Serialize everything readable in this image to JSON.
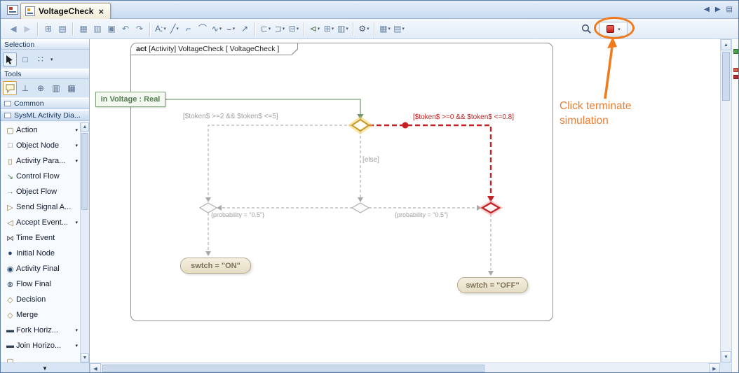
{
  "tab_bar": {
    "tab": {
      "title": "VoltageCheck",
      "close_glyph": "×"
    },
    "nav_prev": "◀",
    "nav_next": "▶",
    "nav_list": "▤"
  },
  "toolbar": {
    "groups": {
      "g1": [
        {
          "name": "back-button",
          "icon": "back-icon",
          "glyph": "◀",
          "color": "#7c95b6"
        },
        {
          "name": "forward-button",
          "icon": "forward-icon",
          "glyph": "▶",
          "color": "#b9c6d8"
        }
      ],
      "g2": [
        {
          "name": "open-diagram-button",
          "icon": "diagram-window-icon",
          "glyph": "⊞",
          "color": "#5f7da6"
        },
        {
          "name": "specification-button",
          "icon": "specification-icon",
          "glyph": "▤",
          "color": "#5f7da6"
        }
      ],
      "g3": [
        {
          "name": "print-button",
          "icon": "printer-icon",
          "glyph": "▦"
        },
        {
          "name": "copy-button",
          "icon": "copy-icon",
          "glyph": "▥"
        },
        {
          "name": "paste-button",
          "icon": "paste-icon",
          "glyph": "▣"
        },
        {
          "name": "undo-button",
          "icon": "undo-icon",
          "glyph": "↶"
        },
        {
          "name": "redo-button",
          "icon": "redo-icon",
          "glyph": "↷"
        }
      ],
      "g4": [
        {
          "name": "dependency-button",
          "icon": "dependency-icon",
          "glyph": "A:",
          "color": "#4a6a94",
          "caret": true
        },
        {
          "name": "oblique-path-button",
          "icon": "oblique-line-icon",
          "glyph": "╱",
          "color": "#4a6a94",
          "caret": true
        },
        {
          "name": "rectilinear-path-button",
          "icon": "rectilinear-line-icon",
          "glyph": "⌐",
          "color": "#4a6a94"
        },
        {
          "name": "rounded-path-button",
          "icon": "rounded-line-icon",
          "glyph": "⌒",
          "color": "#4a6a94"
        },
        {
          "name": "bezier-path-button",
          "icon": "bezier-line-icon",
          "glyph": "∿",
          "color": "#4a6a94",
          "caret": true
        },
        {
          "name": "line-jump-button",
          "icon": "line-jump-icon",
          "glyph": "⌣",
          "color": "#4a6a94",
          "caret": true
        },
        {
          "name": "reset-path-button",
          "icon": "reset-path-icon",
          "glyph": "↗",
          "color": "#4a6a94"
        }
      ],
      "g5": [
        {
          "name": "align-button",
          "icon": "align-icon",
          "glyph": "⊏",
          "caret": true
        },
        {
          "name": "distribute-button",
          "icon": "distribute-icon",
          "glyph": "⊐",
          "caret": true
        },
        {
          "name": "same-size-button",
          "icon": "resize-icon",
          "glyph": "⊟",
          "caret": true
        }
      ],
      "g6": [
        {
          "name": "related-elements-button",
          "icon": "related-elements-icon",
          "glyph": "⊲",
          "color": "#5a7a4a",
          "caret": true
        },
        {
          "name": "nested-elements-button",
          "icon": "nested-elements-icon",
          "glyph": "⊞",
          "caret": true
        },
        {
          "name": "layers-button",
          "icon": "layers-icon",
          "glyph": "▥",
          "caret": true
        }
      ],
      "g7": [
        {
          "name": "display-options-button",
          "icon": "gear-icon",
          "glyph": "⚙",
          "color": "#4a5a6a",
          "caret": true
        }
      ],
      "g8": [
        {
          "name": "grid-button",
          "icon": "grid-icon",
          "glyph": "▦",
          "caret": true
        },
        {
          "name": "diagram-properties-button",
          "icon": "properties-icon",
          "glyph": "▤",
          "caret": true
        }
      ]
    },
    "terminate": {
      "caret": "▾"
    }
  },
  "palette": {
    "sections": {
      "selection": "Selection",
      "tools": "Tools",
      "common": "Common",
      "sysml": "SysML Activity Dia..."
    },
    "selection_row": [
      {
        "name": "marquee-select-button",
        "icon": "marquee-select-icon",
        "glyph": "□"
      },
      {
        "name": "multi-select-button",
        "icon": "multi-select-icon",
        "glyph": "∷"
      }
    ],
    "tools_row": [
      {
        "name": "anchor-tool-button",
        "icon": "anchor-icon",
        "glyph": "⊥"
      },
      {
        "name": "containment-tool-button",
        "icon": "containment-icon",
        "glyph": "⊕"
      },
      {
        "name": "swimlane-tool-button",
        "icon": "swimlane-icon",
        "glyph": "▥"
      },
      {
        "name": "image-shape-tool-button",
        "icon": "image-shape-icon",
        "glyph": "▦"
      }
    ],
    "items": [
      {
        "name": "palette-item-action",
        "icon": "action-node-icon",
        "glyph": "▢",
        "icon_color": "#8a7440",
        "label": "Action",
        "dropdown": true
      },
      {
        "name": "palette-item-object-node",
        "icon": "object-node-icon",
        "glyph": "□",
        "icon_color": "#8a7440",
        "label": "Object Node",
        "dropdown": true
      },
      {
        "name": "palette-item-activity-parameter",
        "icon": "activity-parameter-icon",
        "glyph": "▯",
        "icon_color": "#8a7440",
        "label": "Activity Para...",
        "dropdown": true
      },
      {
        "name": "palette-item-control-flow",
        "icon": "control-flow-icon",
        "glyph": "↘",
        "icon_color": "#4f8a4f",
        "label": "Control Flow",
        "dropdown": false
      },
      {
        "name": "palette-item-object-flow",
        "icon": "object-flow-icon",
        "glyph": "→",
        "icon_color": "#4f8a4f",
        "label": "Object Flow",
        "dropdown": false
      },
      {
        "name": "palette-item-send-signal",
        "icon": "send-signal-icon",
        "glyph": "▷",
        "icon_color": "#8a7440",
        "label": "Send Signal A...",
        "dropdown": false
      },
      {
        "name": "palette-item-accept-event",
        "icon": "accept-event-icon",
        "glyph": "◁",
        "icon_color": "#8a7440",
        "label": "Accept Event...",
        "dropdown": true
      },
      {
        "name": "palette-item-time-event",
        "icon": "time-event-icon",
        "glyph": "⋈",
        "icon_color": "#555555",
        "label": "Time Event",
        "dropdown": false
      },
      {
        "name": "palette-item-initial-node",
        "icon": "initial-node-icon",
        "glyph": "●",
        "icon_color": "#24456e",
        "label": "Initial Node",
        "dropdown": false
      },
      {
        "name": "palette-item-activity-final",
        "icon": "activity-final-icon",
        "glyph": "◉",
        "icon_color": "#24456e",
        "label": "Activity Final",
        "dropdown": false
      },
      {
        "name": "palette-item-flow-final",
        "icon": "flow-final-icon",
        "glyph": "⊗",
        "icon_color": "#24456e",
        "label": "Flow Final",
        "dropdown": false
      },
      {
        "name": "palette-item-decision",
        "icon": "decision-icon",
        "glyph": "◇",
        "icon_color": "#ab8b3b",
        "label": "Decision",
        "dropdown": false
      },
      {
        "name": "palette-item-merge",
        "icon": "merge-icon",
        "glyph": "◇",
        "icon_color": "#ab8b3b",
        "label": "Merge",
        "dropdown": false
      },
      {
        "name": "palette-item-fork-horizontal",
        "icon": "fork-horizontal-icon",
        "glyph": "▬",
        "icon_color": "#2f3f55",
        "label": "Fork Horiz...",
        "dropdown": true
      },
      {
        "name": "palette-item-join-horizontal",
        "icon": "join-horizontal-icon",
        "glyph": "▬",
        "icon_color": "#2f3f55",
        "label": "Join Horizo...",
        "dropdown": true
      },
      {
        "name": "palette-item-clipped",
        "icon": "clipped-item-icon",
        "glyph": "▢",
        "icon_color": "#8a7440",
        "label": "",
        "dropdown": false
      }
    ],
    "more_indicator": "▼"
  },
  "canvas": {
    "frame": {
      "kind": "act",
      "title": "[Activity] VoltageCheck [ VoltageCheck ]"
    },
    "parameter_node": "in Voltage : Real",
    "labels": {
      "guard_left": "[$token$ >=2 && $token$ <=5]",
      "guard_red": "[$token$ >=0 && $token$ <=0.8]",
      "else_label": "[else]",
      "probability_left": "{probability = \"0.5\"}",
      "probability_right": "{probability = \"0.5\"}"
    },
    "actions": {
      "on": "swtch = \"ON\"",
      "off": "swtch = \"OFF\""
    }
  },
  "annotation": {
    "text": "Click terminate\nsimulation"
  },
  "colors": {
    "accent_orange": "#ED7D31",
    "active_red": "#C42222",
    "flow_green": "#6E956E",
    "active_yellow": "#C79A2A"
  }
}
